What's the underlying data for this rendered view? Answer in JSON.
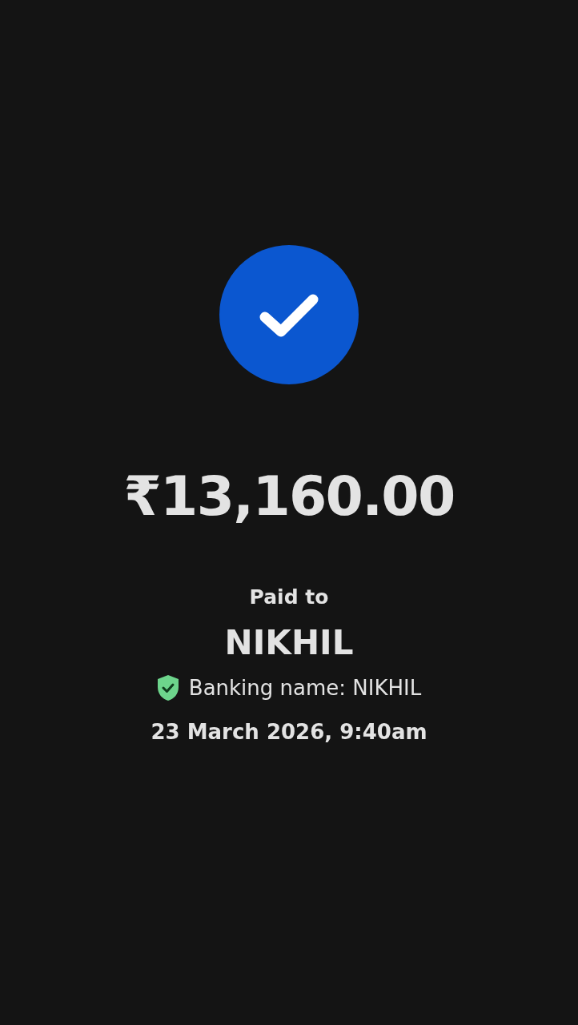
{
  "completed": true,
  "amount": "₹13,160.00",
  "paid_to_label": "Paid to",
  "payee": "NIKHIL",
  "banking_name": {
    "text": "Banking name: NIKHIL",
    "verified": true
  },
  "datetime": "23 March 2026, 9:40am"
}
